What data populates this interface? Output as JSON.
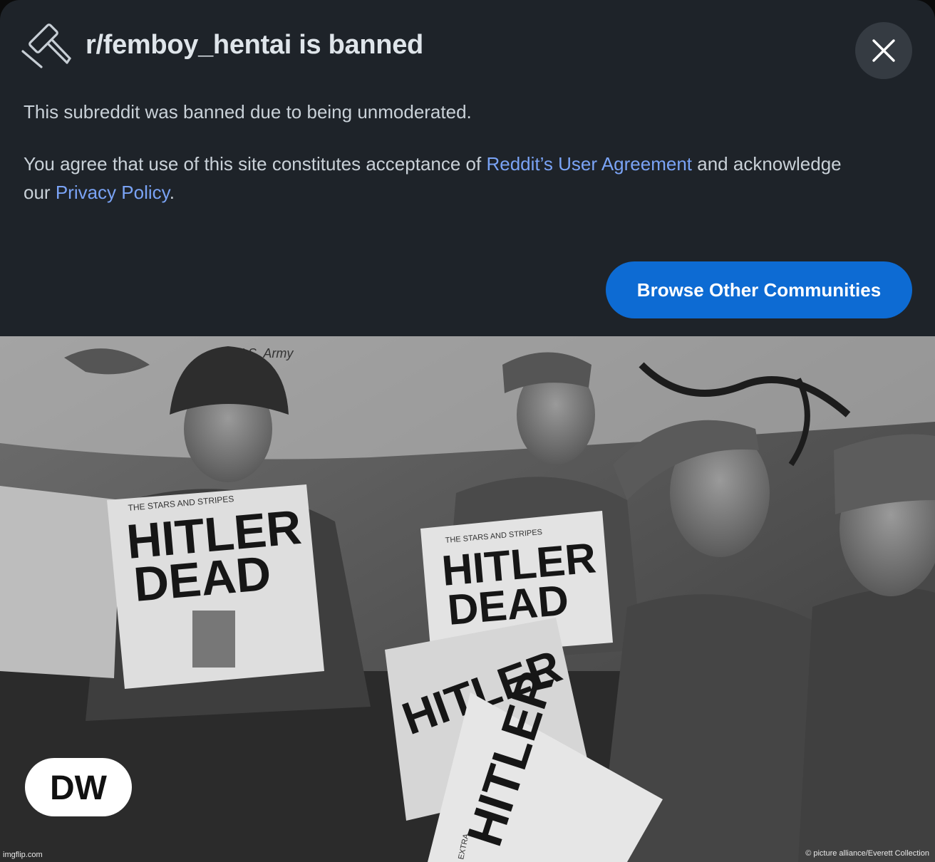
{
  "dialog": {
    "title": "r/femboy_hentai is banned",
    "message": "This subreddit was banned due to being unmoderated.",
    "agreement_prefix": "You agree that use of this site constitutes acceptance of ",
    "user_agreement_link": "Reddit’s User Agreement",
    "agreement_middle": " and acknowledge our ",
    "privacy_link": "Privacy Policy",
    "agreement_suffix": ".",
    "browse_button": "Browse Other Communities",
    "icons": {
      "header": "gavel-icon",
      "close": "close-icon"
    },
    "colors": {
      "background": "#1e2329",
      "link": "#7aa3f5",
      "button": "#0d6bd3"
    }
  },
  "photo": {
    "newspaper_masthead": "THE STARS AND STRIPES",
    "extra_label": "EXTRA",
    "headline_line1": "HITLER",
    "headline_line2": "DEAD",
    "banner_text": "U.S. Army",
    "logo_text": "DW",
    "credit": "© picture alliance/Everett Collection",
    "watermark": "imgflip.com"
  }
}
